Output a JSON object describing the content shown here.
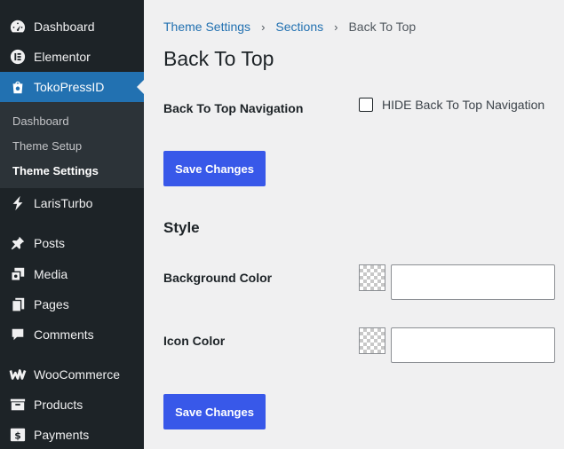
{
  "sidebar": {
    "items_top": [
      {
        "label": "Dashboard",
        "icon": "dashboard-icon"
      },
      {
        "label": "Elementor",
        "icon": "elementor-icon"
      },
      {
        "label": "TokoPressID",
        "icon": "tokopress-icon",
        "active": true
      }
    ],
    "submenu": [
      {
        "label": "Dashboard"
      },
      {
        "label": "Theme Setup"
      },
      {
        "label": "Theme Settings",
        "current": true
      }
    ],
    "items_bottom": [
      {
        "label": "LarisTurbo",
        "icon": "laristurbo-icon"
      },
      {
        "label": "Posts",
        "icon": "pin-icon"
      },
      {
        "label": "Media",
        "icon": "media-icon"
      },
      {
        "label": "Pages",
        "icon": "pages-icon"
      },
      {
        "label": "Comments",
        "icon": "comments-icon"
      },
      {
        "label": "WooCommerce",
        "icon": "woocommerce-icon"
      },
      {
        "label": "Products",
        "icon": "products-icon"
      },
      {
        "label": "Payments",
        "icon": "payments-icon"
      }
    ]
  },
  "breadcrumb": {
    "item1": "Theme Settings",
    "item2": "Sections",
    "current": "Back To Top"
  },
  "page": {
    "title": "Back To Top",
    "nav_label": "Back To Top Navigation",
    "hide_checkbox_label": "HIDE Back To Top Navigation",
    "save_label": "Save Changes",
    "style_title": "Style",
    "bg_color_label": "Background Color",
    "icon_color_label": "Icon Color",
    "bg_color_value": "",
    "icon_color_value": ""
  },
  "colors": {
    "sidebar_bg": "#1d2327",
    "active_bg": "#2271b1",
    "button_bg": "#3858e9",
    "link": "#2271b1"
  }
}
